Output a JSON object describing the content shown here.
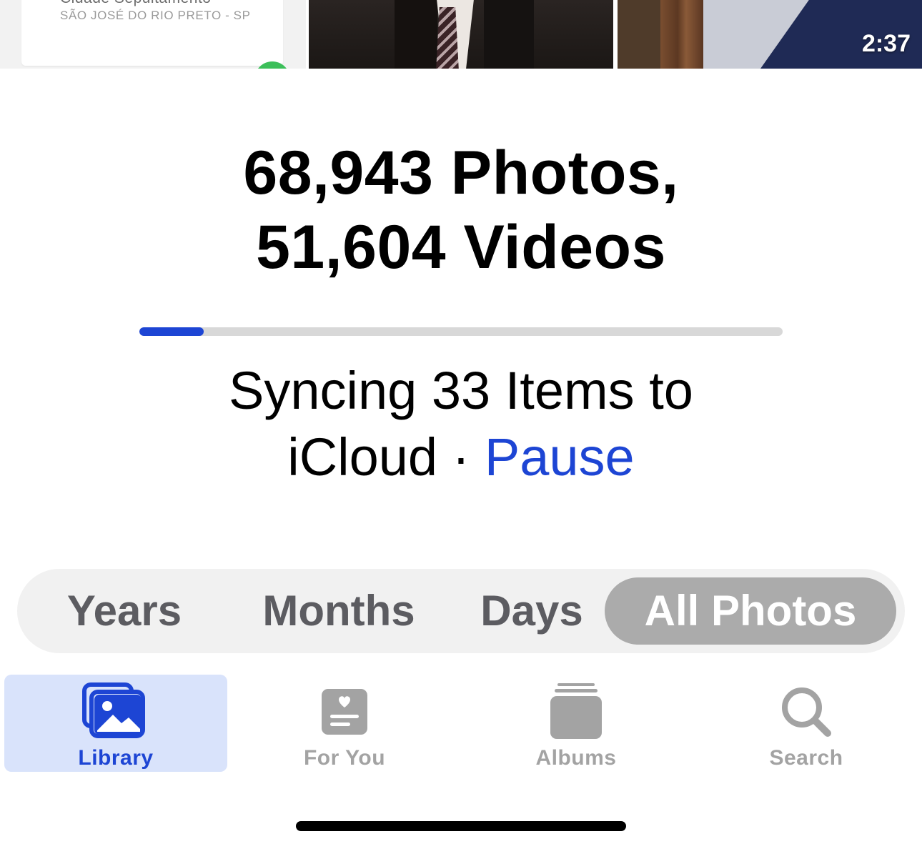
{
  "thumbnails": {
    "items": [
      {
        "clipped_text": "Cidade Sepultamento",
        "subtitle": "SÃO JOSÉ DO RIO PRETO - SP"
      },
      {
        "kind": "photo"
      },
      {
        "kind": "video",
        "duration": "2:37"
      }
    ]
  },
  "library": {
    "photos_count": "68,943 Photos,",
    "videos_count": "51,604 Videos"
  },
  "sync": {
    "progress_fraction": 0.1,
    "line1": "Syncing 33 Items to",
    "line2": "iCloud · ",
    "pause_label": "Pause"
  },
  "segmented_control": {
    "options": [
      "Years",
      "Months",
      "Days",
      "All Photos"
    ],
    "selected": "All Photos"
  },
  "tab_bar": {
    "tabs": [
      {
        "label": "Library",
        "icon": "library-icon",
        "selected": true
      },
      {
        "label": "For You",
        "icon": "for-you-icon",
        "selected": false
      },
      {
        "label": "Albums",
        "icon": "albums-icon",
        "selected": false
      },
      {
        "label": "Search",
        "icon": "search-icon",
        "selected": false
      }
    ]
  },
  "colors": {
    "accent": "#1d45d4",
    "selected_tab_bg": "#d9e3fb",
    "segment_selected_bg": "#ababab",
    "inactive_gray": "#a3a3a3"
  }
}
